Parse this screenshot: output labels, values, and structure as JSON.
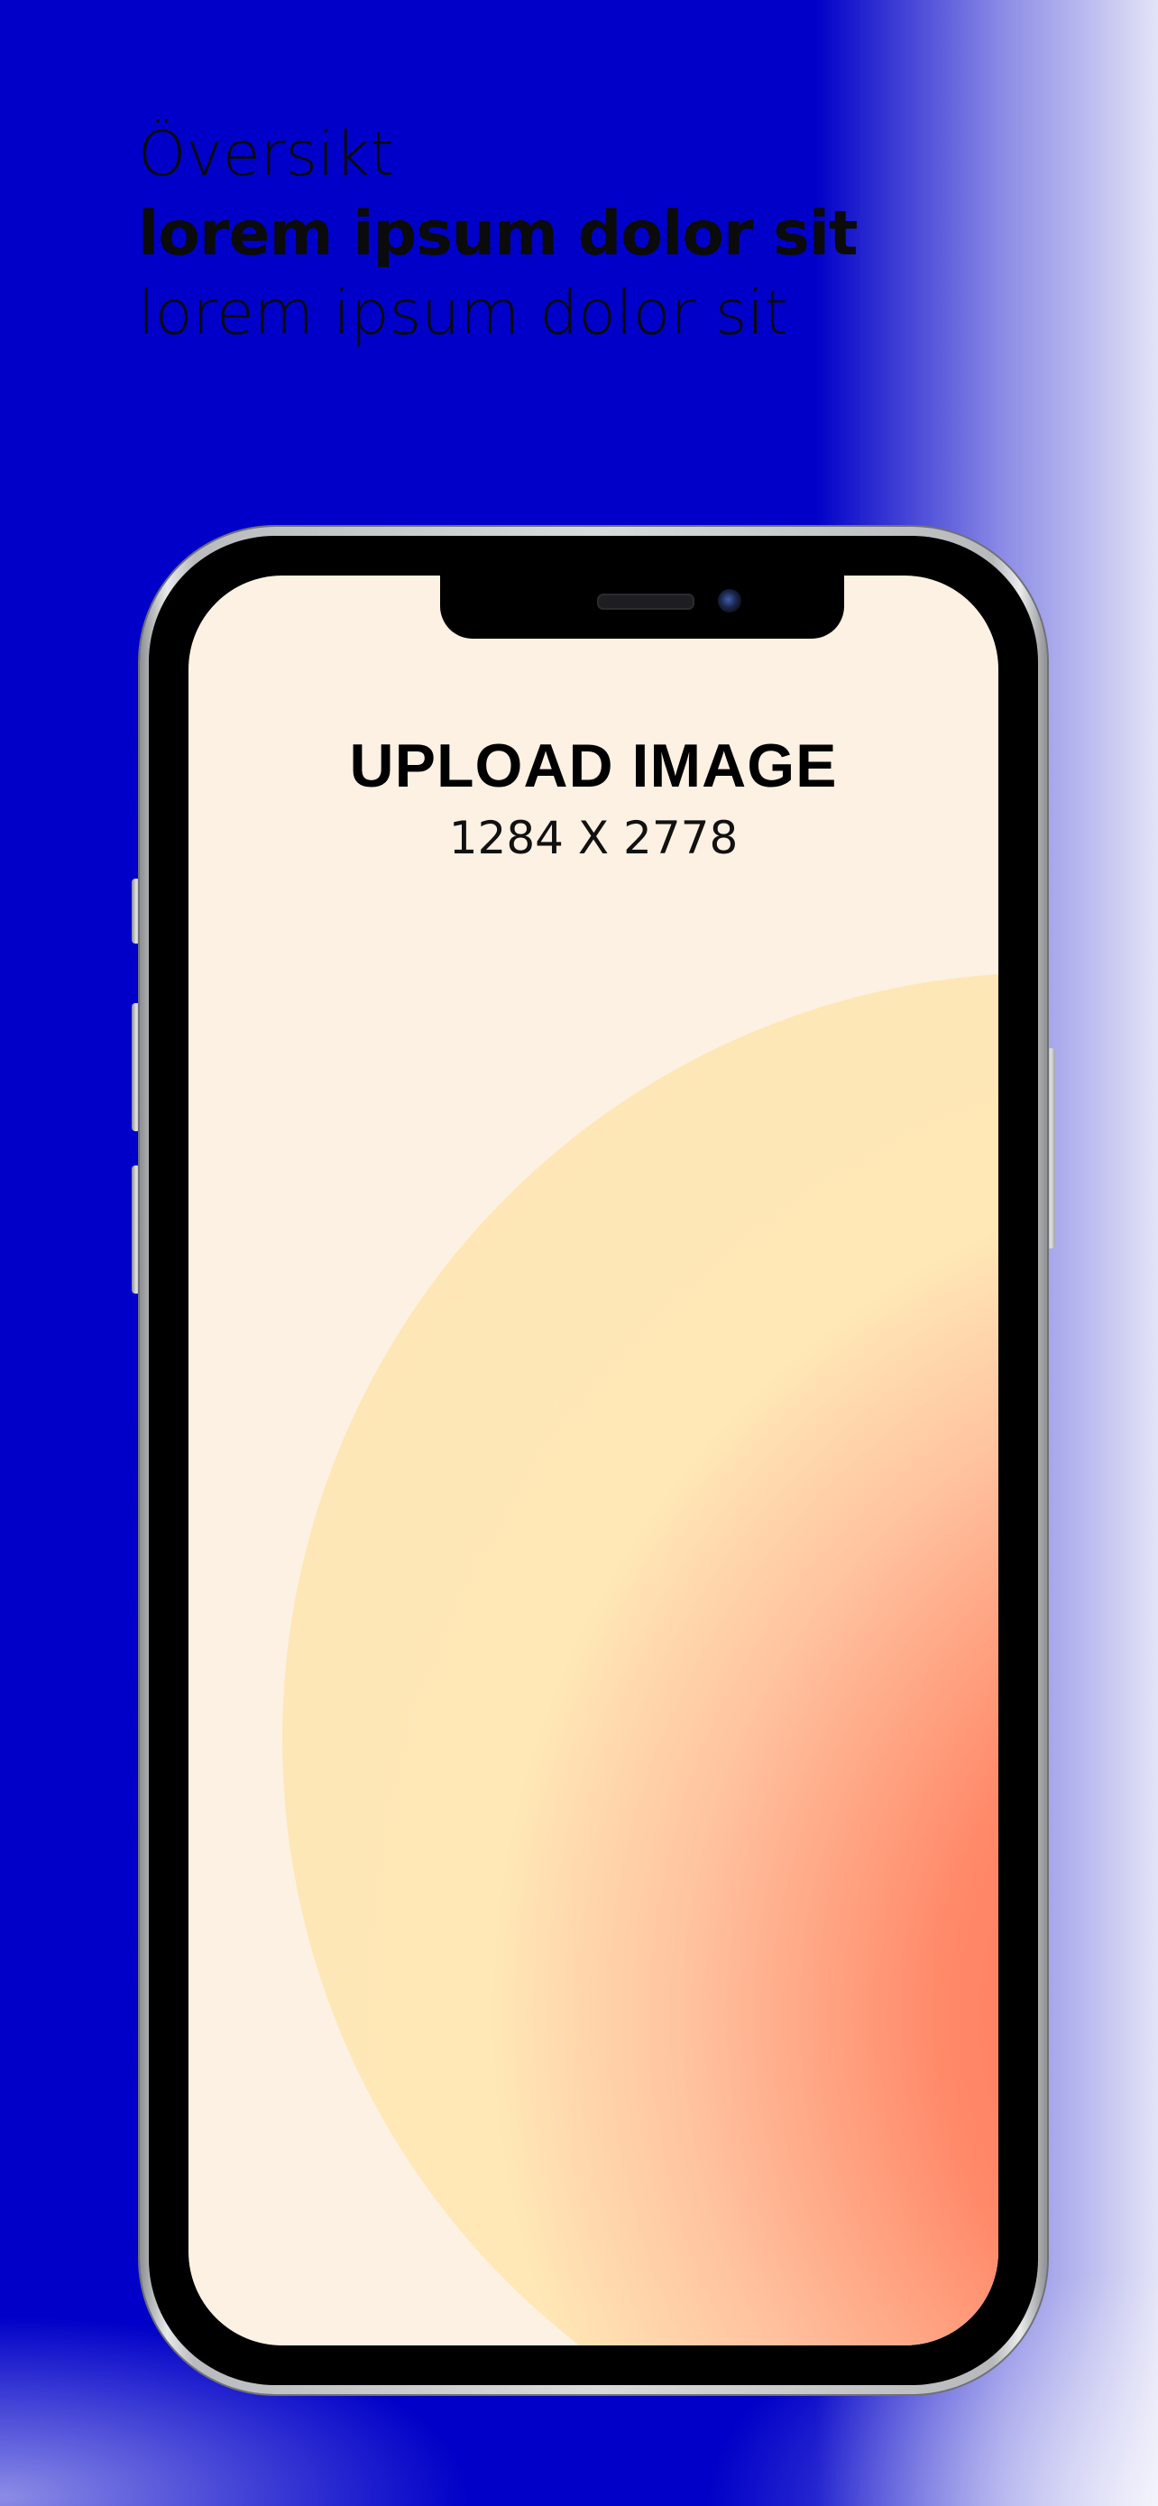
{
  "heading": {
    "line1": "Översikt",
    "line2": "lorem ipsum dolor sit",
    "line3": "lorem ipsum dolor sit"
  },
  "screen": {
    "title": "UPLOAD IMAGE",
    "subtitle": "1284 X 2778"
  },
  "colors": {
    "background": "#0000c8",
    "screen_background": "#fcf1e2",
    "blob_warm": "#ffe8b6",
    "blob_hot": "#ff5b4a",
    "phone_frame": "#d9dadc"
  }
}
